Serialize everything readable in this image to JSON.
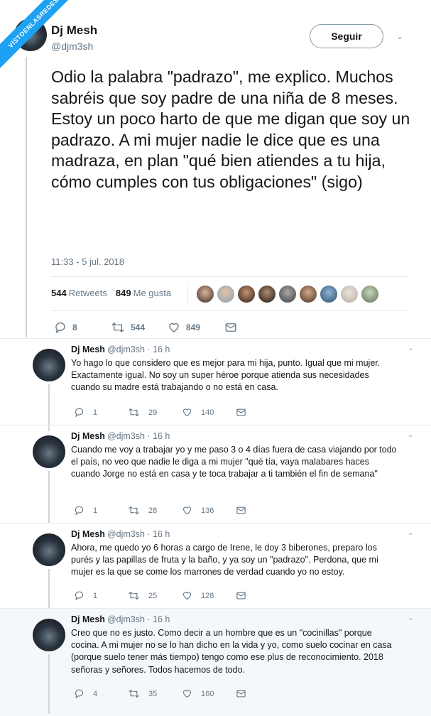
{
  "watermark": "VISTOENLASREDES",
  "colors": {
    "accent": "#1da1f2",
    "muted": "#657786",
    "text": "#14171a",
    "border": "#e6ecf0"
  },
  "main_tweet": {
    "name": "Dj Mesh",
    "handle": "@djm3sh",
    "follow_label": "Seguir",
    "text": "Odio la palabra \"padrazo\", me explico. Muchos sabréis que soy padre de una niña de 8 meses. Estoy un poco harto de que me digan que soy un padrazo. A mi mujer nadie le dice que es una madraza, en plan \"qué bien atiendes a tu hija, cómo cumples con tus obligaciones\" (sigo)",
    "time": "11:33 - 5 jul. 2018",
    "retweets_count": "544",
    "retweets_label": "Retweets",
    "likes_count": "849",
    "likes_label": "Me gusta",
    "likers_avatar_count": 9,
    "replies": "8",
    "retweets": "544",
    "likes": "849"
  },
  "replies": [
    {
      "name": "Dj Mesh",
      "handle": "@djm3sh · 16 h",
      "text": "Yo hago lo que considero que es mejor para mi hija, punto. Igual que mi mujer. Exactamente igual. No soy un super héroe porque atienda sus necesidades cuando su madre está trabajando o no está en casa.",
      "replies": "1",
      "retweets": "29",
      "likes": "140"
    },
    {
      "name": "Dj Mesh",
      "handle": "@djm3sh · 16 h",
      "text": "Cuando me voy a trabajar yo y me paso 3 o 4 días fuera de casa viajando por todo el país, no veo que nadie le diga a mi mujer \"qué tía, vaya malabares haces cuando Jorge no está en casa y te toca trabajar a ti también el fin de semana\"",
      "replies": "1",
      "retweets": "28",
      "likes": "136"
    },
    {
      "name": "Dj Mesh",
      "handle": "@djm3sh · 16 h",
      "text": "Ahora, me quedo yo 6 horas a cargo de Irene, le doy 3 biberones, preparo los purés y las papillas de fruta y la baño, y ya soy un \"padrazo\". Perdona, que mi mujer es la que se come los marrones de verdad cuando yo no estoy.",
      "replies": "1",
      "retweets": "25",
      "likes": "128"
    },
    {
      "name": "Dj Mesh",
      "handle": "@djm3sh · 16 h",
      "text": "Creo que no es justo. Como decir a un hombre que es un \"cocinillas\" porque cocina. A mi mujer no se lo han dicho en la vida y yo, como suelo cocinar en casa (porque suelo tener más tiempo) tengo como ese plus de reconocimiento. 2018 señoras y señores. Todos hacemos de todo.",
      "replies": "4",
      "retweets": "35",
      "likes": "160"
    }
  ]
}
